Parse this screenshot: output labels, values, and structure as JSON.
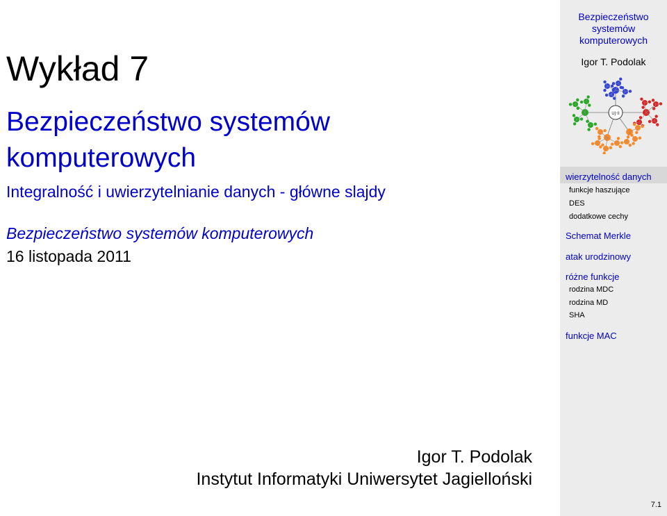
{
  "slide": {
    "lecture": "Wykład 7",
    "course_line1": "Bezpieczeństwo systemów",
    "course_line2": "komputerowych",
    "subtitle": "Integralność i uwierzytelnianie danych - główne slajdy",
    "course_italic": "Bezpieczeństwo systemów komputerowych",
    "date": "16 listopada 2011",
    "author": "Igor T. Podolak",
    "institute": "Instytut Informatyki Uniwersytet Jagielloński"
  },
  "sidebar": {
    "title_line1": "Bezpieczeństwo",
    "title_line2": "systemów",
    "title_line3": "komputerowych",
    "author": "Igor T. Podolak",
    "logo_center_label": "UJ·II",
    "nav": [
      {
        "label": "wierzytelność danych",
        "level": 1,
        "active": true
      },
      {
        "label": "funkcje haszujące",
        "level": 2
      },
      {
        "label": "DES",
        "level": 2
      },
      {
        "label": "dodatkowe cechy",
        "level": 2
      },
      {
        "label": "Schemat Merkle",
        "level": 1
      },
      {
        "label": "atak urodzinowy",
        "level": 1
      },
      {
        "label": "różne funkcje",
        "level": 1
      },
      {
        "label": "rodzina MDC",
        "level": 2
      },
      {
        "label": "rodzina MD",
        "level": 2
      },
      {
        "label": "SHA",
        "level": 2
      },
      {
        "label": "funkcje MAC",
        "level": 1
      }
    ],
    "page_number": "7.1"
  },
  "colors": {
    "title_blue": "#0000cc",
    "sidebar_bg": "#ececec",
    "logo_blue": "#3344dd",
    "logo_green": "#22aa22",
    "logo_red": "#dd2222",
    "logo_orange": "#ff8822"
  }
}
